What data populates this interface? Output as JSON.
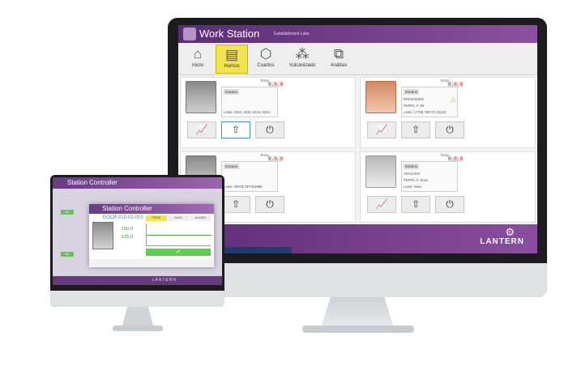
{
  "workstation": {
    "title": "Work Station",
    "subtitle": "Establishment Labs",
    "nav": [
      {
        "label": "Inicio",
        "icon": "home-icon"
      },
      {
        "label": "Hornos",
        "icon": "oven-icon"
      },
      {
        "label": "Cuartos",
        "icon": "box-icon"
      },
      {
        "label": "Vulcanizado",
        "icon": "molecule-icon"
      },
      {
        "label": "Análisis",
        "icon": "analysis-icon"
      }
    ],
    "ovens": [
      {
        "estatus": "Estatus",
        "temp_label": "Temp",
        "temp": "0.0.0",
        "lines": [
          "",
          "",
          "Lotes: 2354, 3434, 5424, 5545"
        ]
      },
      {
        "estatus": "Estatus",
        "temp_label": "Temp",
        "temp": "0.0.0",
        "lines": [
          "ENCENDIDO",
          "PERFIL #: 88",
          "Lotes: 17708,786747,23222"
        ]
      },
      {
        "estatus": "Estatus",
        "temp_label": "Temp",
        "temp": "0.0.0",
        "lines": [
          "",
          "",
          "Lotes: 09878,78778,9985"
        ]
      },
      {
        "estatus": "Estatus",
        "temp_label": "Temp",
        "temp": "0.0.0",
        "lines": [
          "APAGADO",
          "PERFIL #: None",
          "Lotes: None"
        ]
      }
    ],
    "controls": {
      "monitor_icon": "📈",
      "upload_icon": "⇧",
      "power_icon": "⏻"
    },
    "brand": "LANTERN"
  },
  "station_controller": {
    "title": "Station Controller",
    "green_label": "OL",
    "brand": "LANTERN",
    "popup": {
      "title": "Station Controller",
      "code": "EOCR 019-01-003",
      "values": [
        "150.0",
        "125.0"
      ],
      "tabs": [
        "TEMP",
        "HUM",
        "ALARM"
      ],
      "ok_label": "✔"
    }
  }
}
